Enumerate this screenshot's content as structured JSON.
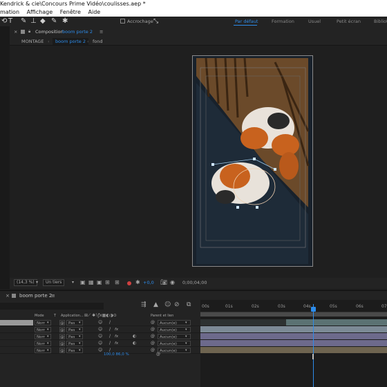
{
  "window": {
    "title": "Kendrick & cie\\Concours Prime Vidéo\\coulisses.aep *"
  },
  "menu": {
    "items": [
      "mation",
      "Affichage",
      "Fenêtre",
      "Aide"
    ]
  },
  "toolbar": {
    "snapping_label": "Accrochage",
    "workspaces": [
      "Par défaut",
      "Formation",
      "Usuel",
      "Petit écran",
      "Bibliot"
    ]
  },
  "composition": {
    "panel_label": "Composition",
    "name": "boom porte 2",
    "breadcrumb": [
      "MONTAGE",
      "boom porte 2",
      "fond"
    ],
    "zoom": "(14,3 %)",
    "resolution": "Un tiers",
    "exposure": "+0,0",
    "timecode": "0;00;04;00"
  },
  "timeline": {
    "tab_name": "boom porte 2",
    "headers": {
      "mode": "Mode",
      "t": "T",
      "application": "Application...",
      "parent": "Parent et lien"
    },
    "ruler": [
      "00s",
      "01s",
      "02s",
      "03s",
      "04s",
      "05s",
      "06s",
      "07s"
    ],
    "layers": [
      {
        "mode": "Norr",
        "application": "Pas",
        "parent": "Aucun(e)",
        "fx": false
      },
      {
        "mode": "Norr",
        "application": "Pas",
        "parent": "Aucun(e)",
        "fx": true
      },
      {
        "mode": "Norr",
        "application": "Pas",
        "parent": "Aucun(e)",
        "fx": true
      },
      {
        "mode": "Norr",
        "application": "Pas",
        "parent": "Aucun(e)",
        "fx": true
      },
      {
        "mode": "Norr",
        "application": "Pas",
        "parent": "Aucun(e)",
        "fx": false
      }
    ],
    "stretch": "100,0 86,0 %"
  },
  "colors": {
    "accent": "#2d8ceb",
    "panel": "#232323",
    "bg": "#1d1d1d"
  }
}
